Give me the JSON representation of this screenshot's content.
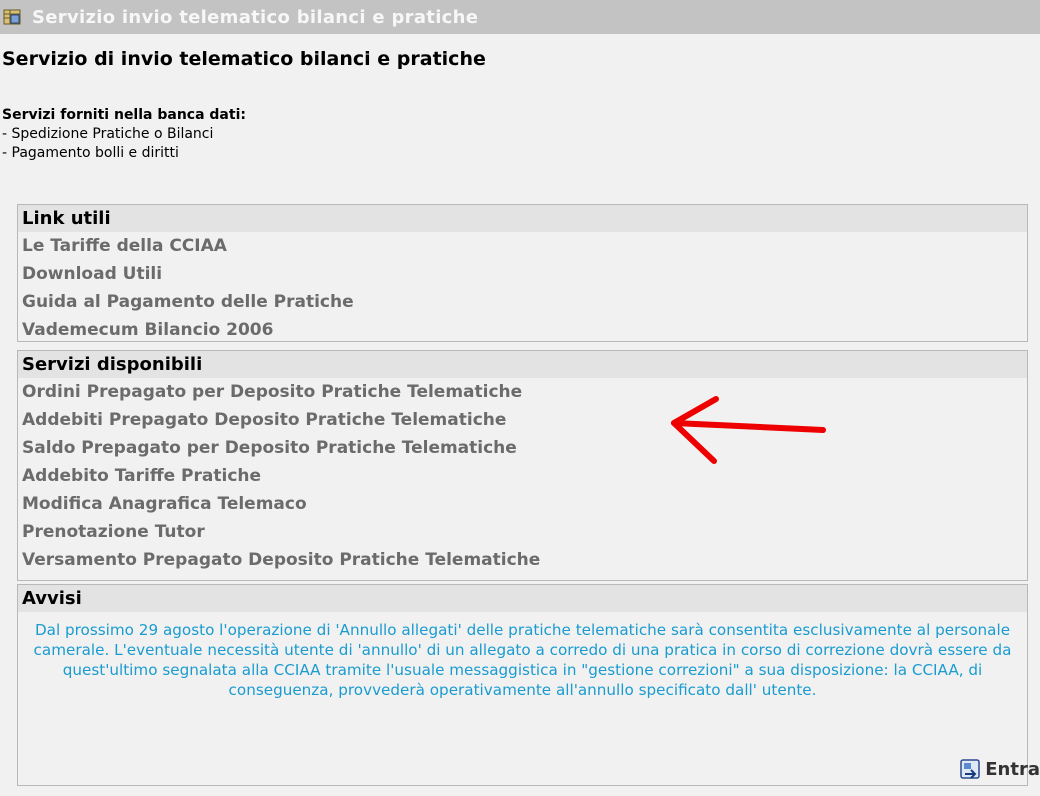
{
  "header": {
    "title": "Servizio invio telematico bilanci e pratiche",
    "subtitle": "Servizio di invio telematico bilanci e pratiche"
  },
  "intro": {
    "title": "Servizi forniti nella banca dati:",
    "items": [
      "- Spedizione Pratiche o Bilanci",
      "- Pagamento bolli e diritti"
    ]
  },
  "useful_links": {
    "heading": "Link utili",
    "items": [
      "Le Tariffe della CCIAA",
      "Download Utili",
      "Guida al Pagamento delle Pratiche",
      "Vademecum Bilancio 2006"
    ]
  },
  "services": {
    "heading": "Servizi disponibili",
    "items": [
      "Ordini Prepagato per Deposito Pratiche Telematiche",
      "Addebiti Prepagato Deposito Pratiche Telematiche",
      "Saldo Prepagato per Deposito Pratiche Telematiche",
      "Addebito Tariffe Pratiche",
      "Modifica Anagrafica Telemaco",
      "Prenotazione Tutor",
      "Versamento Prepagato Deposito Pratiche Telematiche"
    ]
  },
  "notices": {
    "heading": "Avvisi",
    "text": "Dal prossimo 29 agosto l'operazione di 'Annullo allegati' delle pratiche telematiche sarà consentita esclusivamente al personale camerale. L'eventuale necessità utente di 'annullo' di un allegato a corredo di una pratica in corso di correzione dovrà essere da quest'ultimo segnalata alla CCIAA tramite l'usuale messaggistica in \"gestione correzioni\" a sua disposizione: la CCIAA, di conseguenza, provvederà operativamente all'annullo specificato dall' utente."
  },
  "footer": {
    "enter_label": "Entra"
  },
  "colors": {
    "title_bar": "#c3c3c3",
    "link_text": "#6b6b6b",
    "notice_text": "#1a9cd0",
    "annotation_arrow": "#ee0000"
  }
}
